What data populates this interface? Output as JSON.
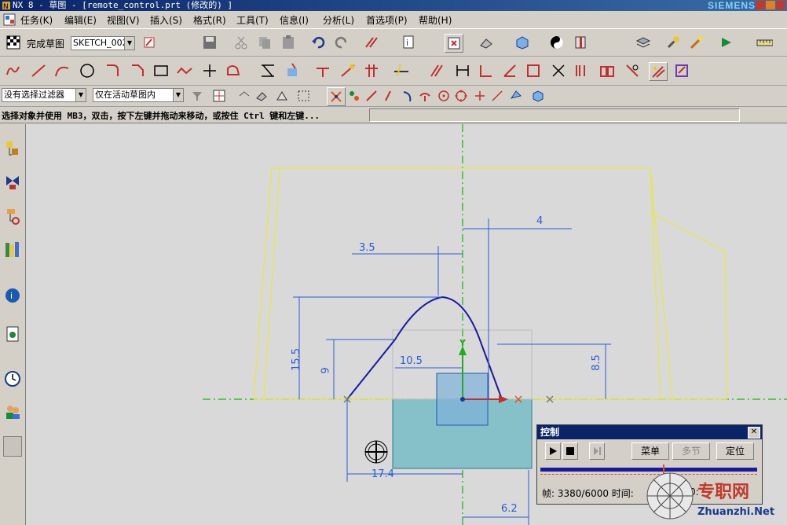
{
  "titlebar": {
    "title": "NX 8 - 草图 - [remote_control.prt (修改的) ]",
    "brand": "SIEMENS"
  },
  "menu": [
    "任务(K)",
    "编辑(E)",
    "视图(V)",
    "插入(S)",
    "格式(R)",
    "工具(T)",
    "信息(I)",
    "分析(L)",
    "首选项(P)",
    "帮助(H)"
  ],
  "toolbar1": {
    "finish_sketch": "完成草图",
    "sketch_name": "SKETCH_002"
  },
  "toolbar3": {
    "filter": "没有选择过滤器",
    "scope": "仅在活动草图内"
  },
  "status": {
    "prompt": "选择对象并使用 MB3，双击，按下左键并拖动来移动，或按住 Ctrl 键和左键..."
  },
  "dimensions": {
    "d_4": "4",
    "d_3_5": "3.5",
    "d_15_5": "15.5",
    "d_9": "9",
    "d_10_5": "10.5",
    "d_8_5": "8.5",
    "d_17_4": "17.4",
    "d_6_2": "6.2"
  },
  "axis": {
    "y": "Y"
  },
  "control_dialog": {
    "title": "控制",
    "menu_btn": "菜单",
    "section_btn": "多节",
    "position_btn": "定位",
    "frame_label": "帧: 3380/6000 时间:",
    "time_tail": "0:"
  },
  "watermark": {
    "cn": "专职网",
    "url": "Zhuanzhi.Net"
  },
  "colors": {
    "sketch_blue": "#1a1aa0",
    "dim_blue": "#2a5bd7",
    "outline_yellow": "#e8e83a",
    "axis_green": "#1fae1f",
    "solid_teal": "#86c0c8"
  }
}
